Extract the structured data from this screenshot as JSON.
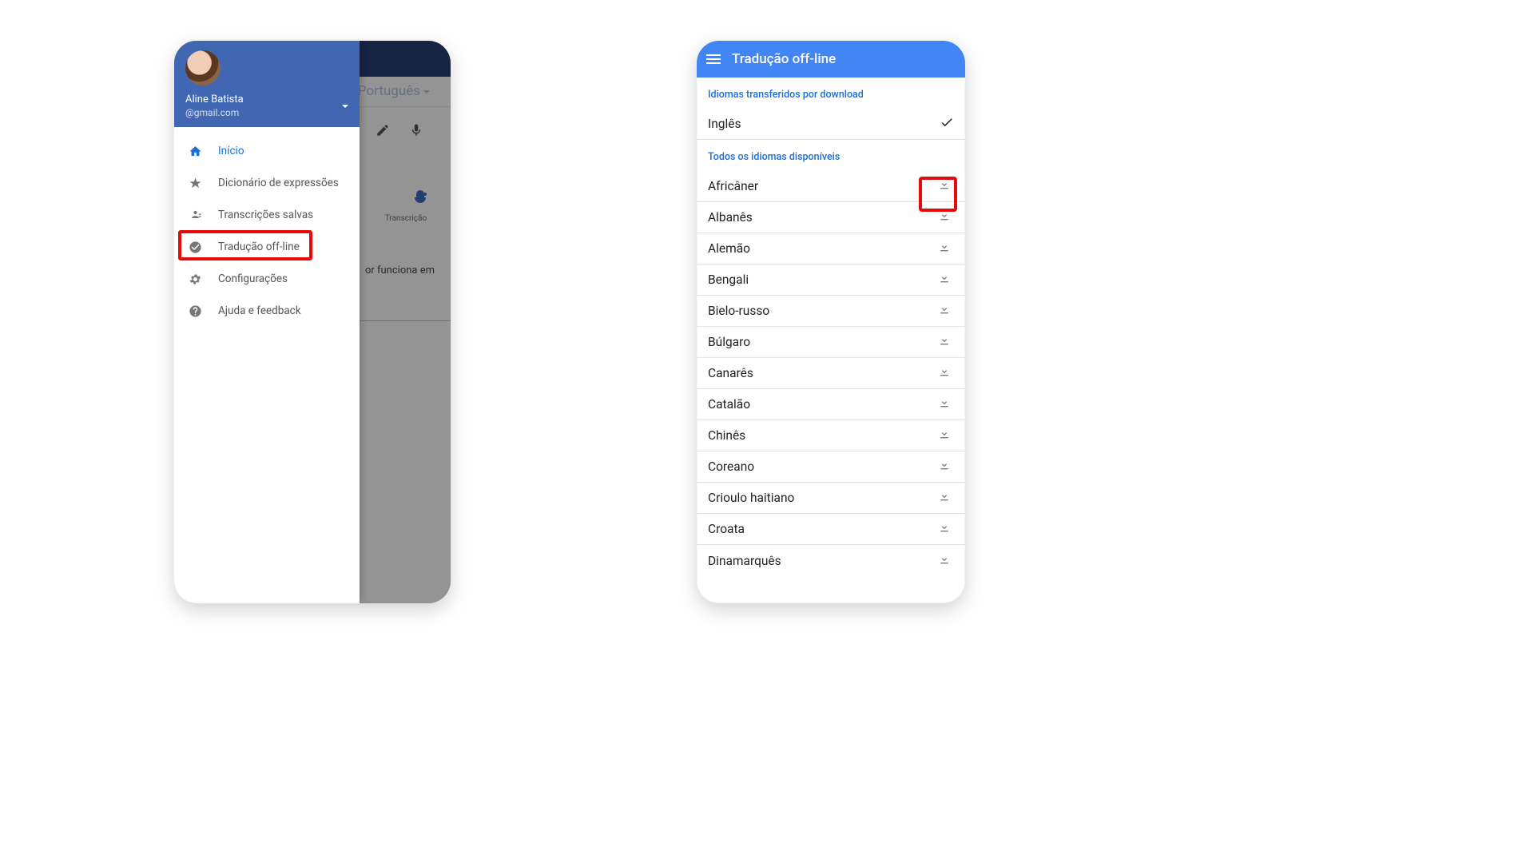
{
  "phone1": {
    "underlying": {
      "target_language": "Português",
      "transcription_label": "Transcrição",
      "works_text": "or funciona em"
    },
    "drawer": {
      "user_name": "Aline Batista",
      "user_email_suffix": "@gmail.com",
      "items": [
        {
          "id": "home",
          "label": "Início",
          "active": true
        },
        {
          "id": "phrasebook",
          "label": "Dicionário de expressões",
          "active": false
        },
        {
          "id": "saved",
          "label": "Transcrições salvas",
          "active": false
        },
        {
          "id": "offline",
          "label": "Tradução off-line",
          "active": false
        },
        {
          "id": "settings",
          "label": "Configurações",
          "active": false
        },
        {
          "id": "help",
          "label": "Ajuda e feedback",
          "active": false
        }
      ]
    }
  },
  "phone2": {
    "title": "Tradução off-line",
    "section_downloaded": "Idiomas transferidos por download",
    "downloaded": [
      {
        "name": "Inglês"
      }
    ],
    "section_available": "Todos os idiomas disponíveis",
    "available": [
      {
        "name": "Africâner"
      },
      {
        "name": "Albanês"
      },
      {
        "name": "Alemão"
      },
      {
        "name": "Bengali"
      },
      {
        "name": "Bielo-russo"
      },
      {
        "name": "Búlgaro"
      },
      {
        "name": "Canarês"
      },
      {
        "name": "Catalão"
      },
      {
        "name": "Chinês"
      },
      {
        "name": "Coreano"
      },
      {
        "name": "Crioulo haitiano"
      },
      {
        "name": "Croata"
      },
      {
        "name": "Dinamarquês"
      }
    ]
  },
  "highlight_color": "#e30b0b"
}
